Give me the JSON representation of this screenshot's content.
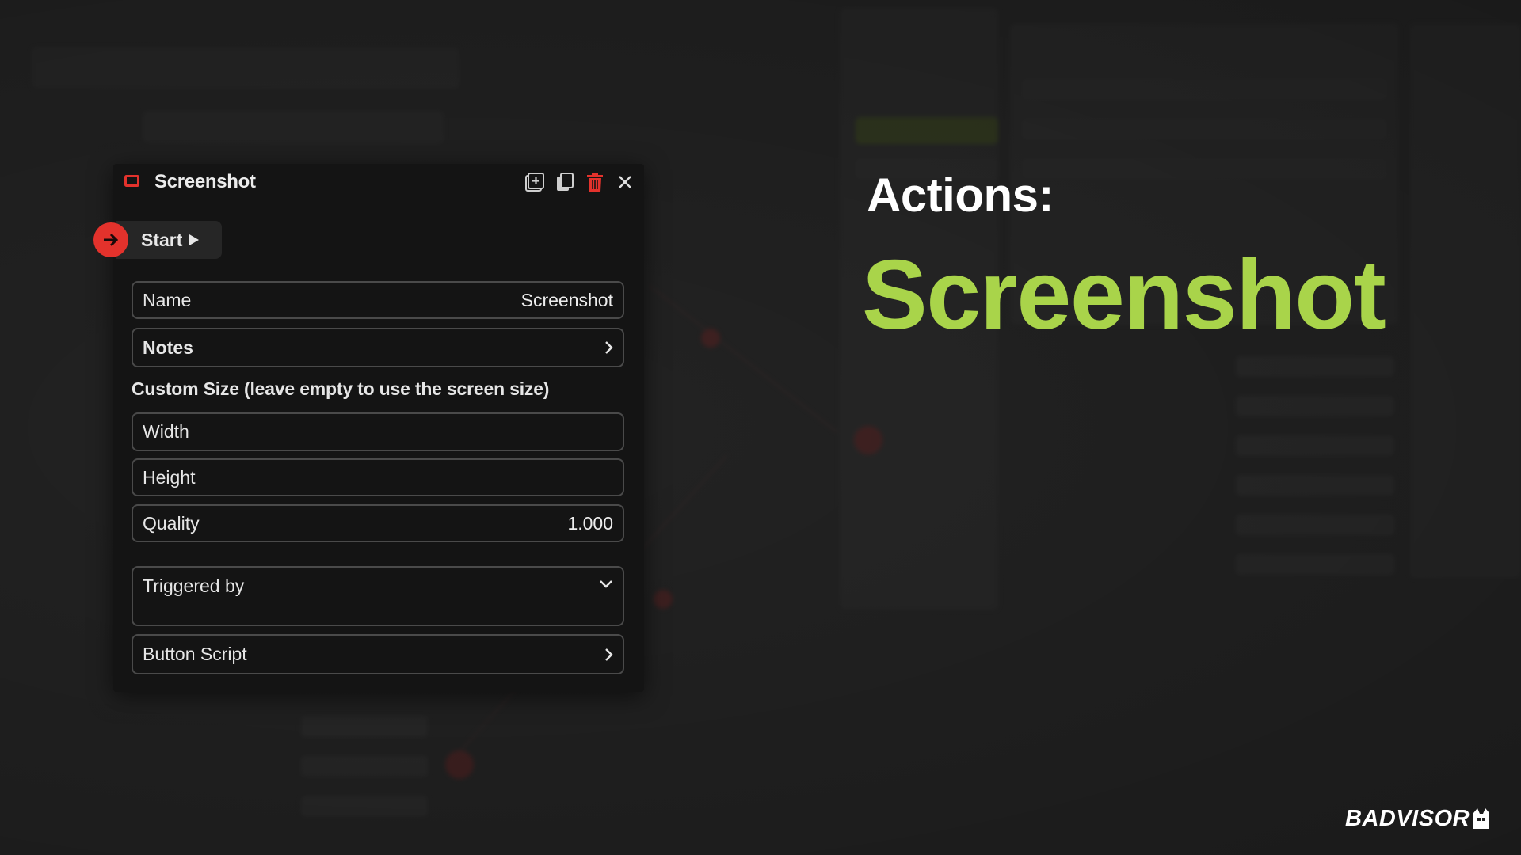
{
  "panel": {
    "title": "Screenshot",
    "start_label": "Start",
    "fields": {
      "name_label": "Name",
      "name_value": "Screenshot",
      "notes_label": "Notes",
      "custom_size_label": "Custom Size (leave empty to use the screen size)",
      "width_label": "Width",
      "height_label": "Height",
      "quality_label": "Quality",
      "quality_value": "1.000",
      "triggered_by_label": "Triggered by",
      "button_script_label": "Button Script"
    },
    "toolbar_icons": [
      "add-icon",
      "duplicate-icon",
      "trash-icon",
      "close-icon"
    ]
  },
  "headline": {
    "kicker": "Actions:",
    "title": "Screenshot"
  },
  "brand": {
    "logo_text": "BADVISOR"
  },
  "colors": {
    "accent_red": "#e3322c",
    "title_green": "#a9d44a",
    "panel_bg": "#141414",
    "page_bg": "#232323"
  }
}
